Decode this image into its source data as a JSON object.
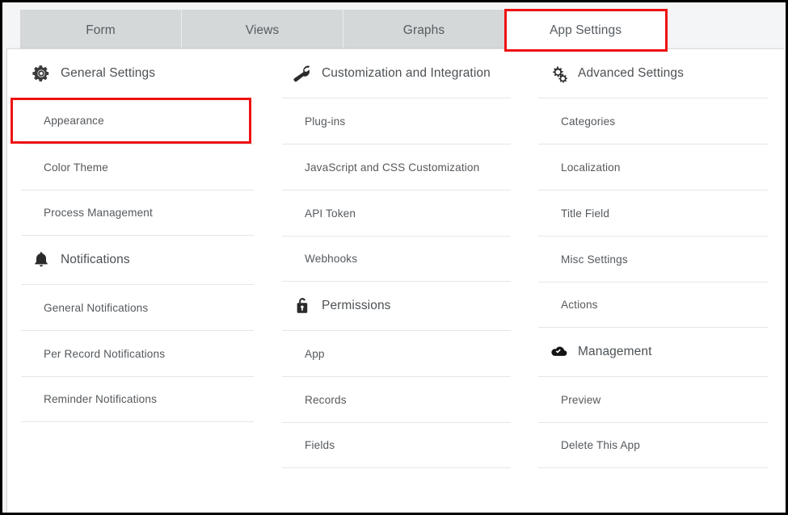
{
  "tabs": [
    {
      "label": "Form",
      "active": false,
      "highlight": false
    },
    {
      "label": "Views",
      "active": false,
      "highlight": false
    },
    {
      "label": "Graphs",
      "active": false,
      "highlight": false
    },
    {
      "label": "App Settings",
      "active": true,
      "highlight": true
    }
  ],
  "colors": {
    "highlight": "#ee1111",
    "tab_inactive_bg": "#d4d8d9",
    "tab_active_bg": "#ffffff",
    "text": "#55595d",
    "divider": "#e6e6e6"
  },
  "columns": [
    {
      "groups": [
        {
          "icon": "gear-icon",
          "title": "General Settings",
          "items": [
            {
              "label": "Appearance",
              "highlight": true
            },
            {
              "label": "Color Theme",
              "highlight": false
            },
            {
              "label": "Process Management",
              "highlight": false
            }
          ]
        },
        {
          "icon": "bell-icon",
          "title": "Notifications",
          "items": [
            {
              "label": "General Notifications",
              "highlight": false
            },
            {
              "label": "Per Record Notifications",
              "highlight": false
            },
            {
              "label": "Reminder Notifications",
              "highlight": false
            }
          ]
        }
      ]
    },
    {
      "groups": [
        {
          "icon": "wrench-icon",
          "title": "Customization and Integration",
          "items": [
            {
              "label": "Plug-ins",
              "highlight": false
            },
            {
              "label": "JavaScript and CSS Customization",
              "highlight": false
            },
            {
              "label": "API Token",
              "highlight": false
            },
            {
              "label": "Webhooks",
              "highlight": false
            }
          ]
        },
        {
          "icon": "lock-icon",
          "title": "Permissions",
          "items": [
            {
              "label": "App",
              "highlight": false
            },
            {
              "label": "Records",
              "highlight": false
            },
            {
              "label": "Fields",
              "highlight": false
            }
          ]
        }
      ]
    },
    {
      "groups": [
        {
          "icon": "double-gear-icon",
          "title": "Advanced Settings",
          "items": [
            {
              "label": "Categories",
              "highlight": false
            },
            {
              "label": "Localization",
              "highlight": false
            },
            {
              "label": "Title Field",
              "highlight": false
            },
            {
              "label": "Misc Settings",
              "highlight": false
            },
            {
              "label": "Actions",
              "highlight": false
            }
          ]
        },
        {
          "icon": "cloud-check-icon",
          "title": "Management",
          "items": [
            {
              "label": "Preview",
              "highlight": false
            },
            {
              "label": "Delete This App",
              "highlight": false
            }
          ]
        }
      ]
    }
  ]
}
